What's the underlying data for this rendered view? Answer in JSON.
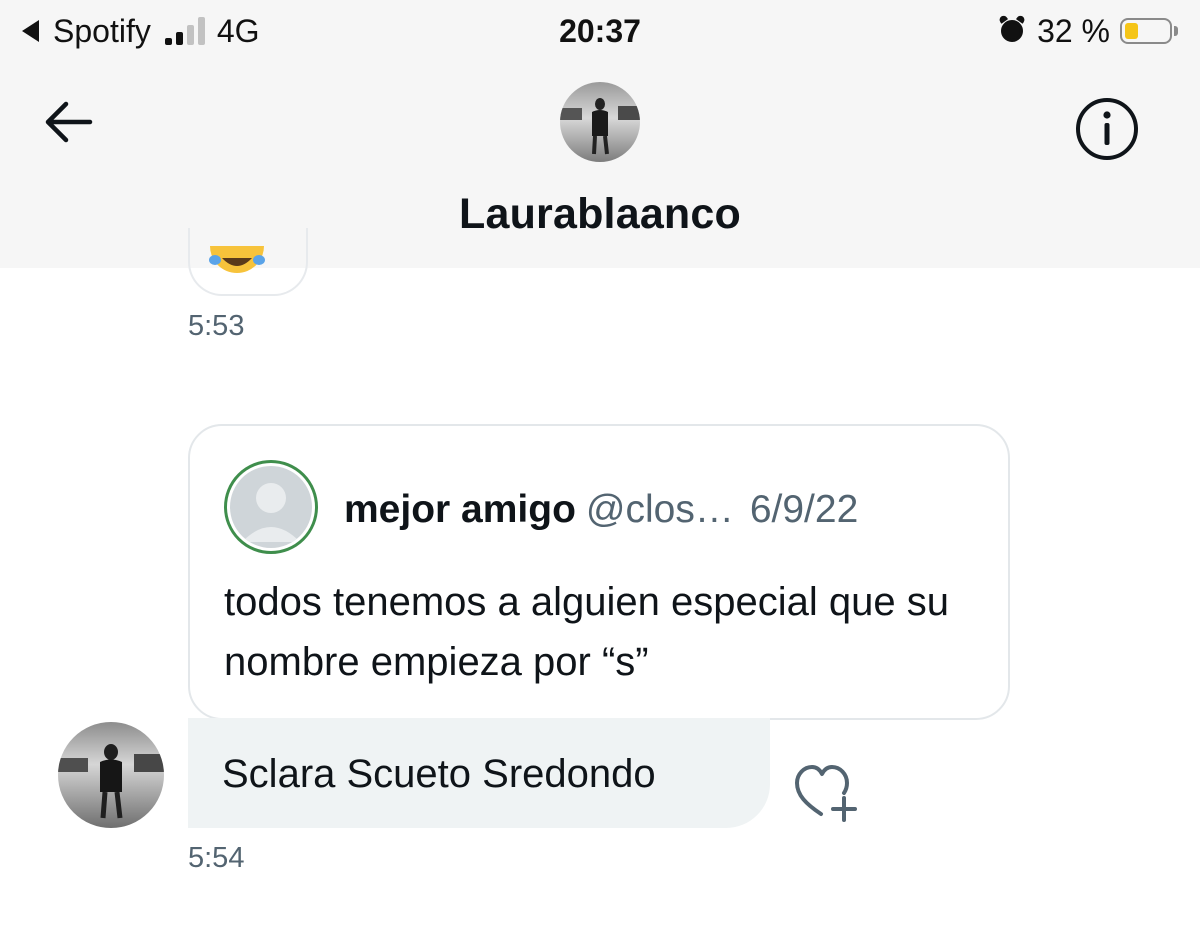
{
  "status_bar": {
    "back_app": "Spotify",
    "network": "4G",
    "time": "20:37",
    "battery": "32 %",
    "battery_level": 0.32,
    "battery_color": "#f5c518"
  },
  "header": {
    "title": "Laurablaanco",
    "back_icon": "arrow-left-icon",
    "info_icon": "info-circle-icon"
  },
  "messages": [
    {
      "type": "emoji",
      "icon": "crying-emoji-icon",
      "timestamp": "5:53"
    },
    {
      "type": "shared_tweet",
      "quoted": {
        "name": "mejor amigo",
        "handle": "@clos…",
        "date": "6/9/22",
        "text": "todos tenemos a alguien especial que su nombre empieza por “s”"
      },
      "reply": "Sclara Scueto Sredondo",
      "react_icon": "heart-plus-icon",
      "timestamp": "5:54"
    }
  ],
  "colors": {
    "text_primary": "#0f1419",
    "text_secondary": "#536471",
    "bubble_bg": "#eff3f4",
    "border": "#e3e7ea",
    "avatar_ring": "#3f8e4c"
  }
}
